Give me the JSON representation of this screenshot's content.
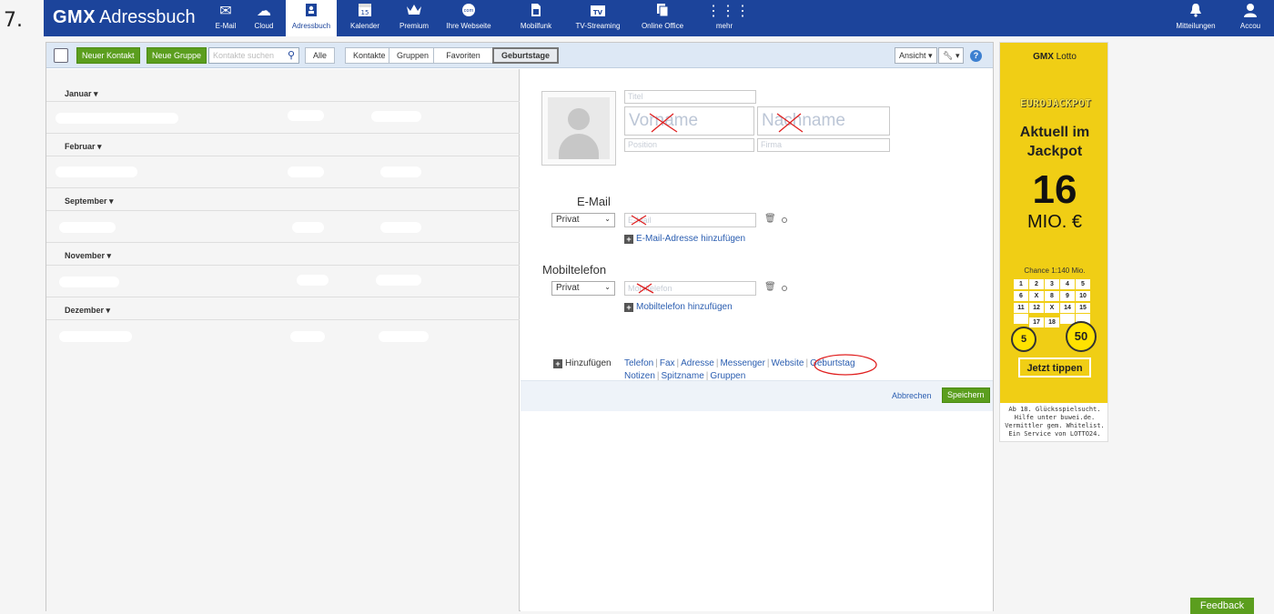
{
  "step_number": "7.",
  "app": {
    "brand_bold": "GMX",
    "brand_title": "Adressbuch"
  },
  "nav": [
    {
      "id": "email",
      "label": "E-Mail",
      "icon": "mail-icon"
    },
    {
      "id": "cloud",
      "label": "Cloud",
      "icon": "cloud-icon"
    },
    {
      "id": "adressbuch",
      "label": "Adressbuch",
      "icon": "contacts-icon",
      "active": true
    },
    {
      "id": "kalender",
      "label": "Kalender",
      "icon": "calendar-icon",
      "glyph_text": "15"
    },
    {
      "id": "premium",
      "label": "Premium",
      "icon": "crown-icon"
    },
    {
      "id": "webseite",
      "label": "Ihre Webseite",
      "icon": "globe-icon",
      "glyph_text": "com"
    },
    {
      "id": "mobilfunk",
      "label": "Mobilfunk",
      "icon": "sim-icon"
    },
    {
      "id": "tv",
      "label": "TV-Streaming",
      "icon": "tv-icon",
      "glyph_text": "TV"
    },
    {
      "id": "office",
      "label": "Online Office",
      "icon": "office-icon"
    },
    {
      "id": "mehr",
      "label": "mehr",
      "icon": "grid-icon"
    }
  ],
  "nav_right": [
    {
      "id": "mitteilungen",
      "label": "Mitteilungen",
      "icon": "bell-icon"
    },
    {
      "id": "account",
      "label": "Accou",
      "icon": "user-icon"
    }
  ],
  "toolbar": {
    "new_contact": "Neuer Kontakt",
    "new_group": "Neue Gruppe",
    "search_placeholder": "Kontakte suchen",
    "filters": [
      "Alle",
      "Kontakte",
      "Gruppen",
      "Favoriten",
      "Geburtstage"
    ],
    "active_filter": "Geburtstage",
    "view": "Ansicht",
    "help": "?"
  },
  "months": [
    {
      "name": "Januar"
    },
    {
      "name": "Februar"
    },
    {
      "name": "September"
    },
    {
      "name": "November"
    },
    {
      "name": "Dezember"
    }
  ],
  "form": {
    "title_placeholder": "Titel",
    "first_name_placeholder": "Vorname",
    "last_name_placeholder": "Nachname",
    "position_placeholder": "Position",
    "company_placeholder": "Firma",
    "email_section": "E-Mail",
    "email_type": "Privat",
    "email_placeholder": "E-Mail",
    "add_email": "E-Mail-Adresse hinzufügen",
    "phone_section": "Mobiltelefon",
    "phone_type": "Privat",
    "phone_placeholder": "Mobiltelefon",
    "add_phone": "Mobiltelefon hinzufügen",
    "add_label": "Hinzufügen",
    "add_links_row1": [
      "Telefon",
      "Fax",
      "Adresse",
      "Messenger",
      "Website",
      "Geburtstag"
    ],
    "add_links_row2": [
      "Notizen",
      "Spitzname",
      "Gruppen"
    ],
    "cancel": "Abbrechen",
    "save": "Speichern"
  },
  "ad": {
    "brand_bold": "GMX",
    "brand": "Lotto",
    "game": "EUROJACKPOT",
    "headline_line1": "Aktuell im",
    "headline_line2": "Jackpot",
    "amount": "16",
    "unit": "MIO. €",
    "chance": "Chance 1:140 Mio.",
    "grid_numbers": [
      "1",
      "2",
      "3",
      "4",
      "5",
      "6",
      "X",
      "8",
      "9",
      "10",
      "11",
      "12",
      "X",
      "14",
      "15",
      "",
      "17",
      "18",
      "",
      ""
    ],
    "cta": "Jetzt tippen",
    "disclaimer": "Ab 18. Glücksspielsucht. Hilfe unter buwei.de. Vermittler gem. Whitelist. Ein Service von LOTTO24."
  },
  "feedback": "Feedback",
  "colors": {
    "header": "#1c449b",
    "green": "#5b9e1e",
    "link": "#2a5db0",
    "ad_yellow": "#f0ce15"
  }
}
